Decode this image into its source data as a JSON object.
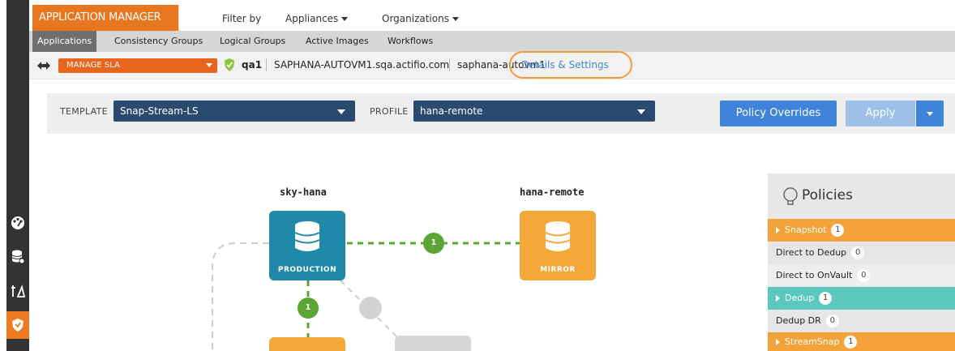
{
  "header": {
    "app_title": "APPLICATION MANAGER",
    "filter_by": "Filter by",
    "appliances": "Appliances",
    "organizations": "Organizations"
  },
  "tabs": [
    {
      "label": "Applications",
      "active": true
    },
    {
      "label": "Consistency Groups",
      "active": false
    },
    {
      "label": "Logical Groups",
      "active": false
    },
    {
      "label": "Active Images",
      "active": false
    },
    {
      "label": "Workflows",
      "active": false
    }
  ],
  "breadcrumb": {
    "manage_sla": "MANAGE SLA",
    "cluster": "qa1",
    "host": "SAPHANA-AUTOVM1.sqa.actifio.com",
    "app": "saphana-autovm1",
    "details_link": "Details & Settings"
  },
  "template_bar": {
    "template_label": "TEMPLATE",
    "template_value": "Snap-Stream-LS",
    "profile_label": "PROFILE",
    "profile_value": "hana-remote",
    "policy_overrides": "Policy Overrides",
    "apply": "Apply"
  },
  "canvas": {
    "source_title": "sky-hana",
    "source_label": "PRODUCTION",
    "target_title": "hana-remote",
    "target_label": "MIRROR",
    "link_badge_h": "1",
    "link_badge_v": "1"
  },
  "policies": {
    "title": "Policies",
    "rows": [
      {
        "label": "Snapshot",
        "count": "1",
        "style": "orange",
        "expandable": true
      },
      {
        "label": "Direct to Dedup",
        "count": "0",
        "style": "gray",
        "expandable": false
      },
      {
        "label": "Direct to OnVault",
        "count": "0",
        "style": "gray2",
        "expandable": false
      },
      {
        "label": "Dedup",
        "count": "1",
        "style": "teal",
        "expandable": true
      },
      {
        "label": "Dedup DR",
        "count": "0",
        "style": "gray",
        "expandable": false
      },
      {
        "label": "StreamSnap",
        "count": "1",
        "style": "orange",
        "expandable": true
      }
    ]
  },
  "colors": {
    "brand_orange": "#e8761e",
    "production_teal": "#1f8aa8",
    "mirror_orange": "#f4a83a",
    "link_green": "#5aa533",
    "primary_blue": "#3f84d8"
  },
  "icons": {
    "sidebar": [
      "dashboard-icon",
      "database-icon",
      "workflow-icon",
      "shield-icon"
    ]
  }
}
